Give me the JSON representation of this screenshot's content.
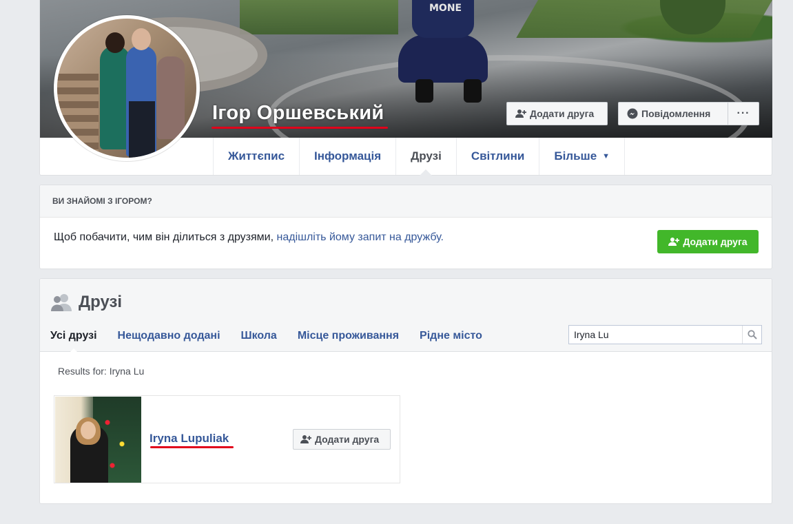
{
  "profile": {
    "name": "Ігор Оршевський",
    "cover_shirt_text": "MONE",
    "add_friend_label": "Додати друга",
    "message_label": "Повідомлення",
    "more_label": "···"
  },
  "nav": {
    "items": [
      {
        "label": "Життєпис"
      },
      {
        "label": "Інформація"
      },
      {
        "label": "Друзі"
      },
      {
        "label": "Світлини"
      },
      {
        "label": "Більше"
      }
    ],
    "active": "Друзі"
  },
  "know": {
    "header": "ВИ ЗНАЙОМІ З ІГОРОМ?",
    "text": "Щоб побачити, чим він ділиться з друзями, ",
    "link": "надішліть йому запит на дружбу.",
    "button": "Додати друга"
  },
  "friends": {
    "title": "Друзі",
    "tabs": [
      {
        "label": "Усі друзі"
      },
      {
        "label": "Нещодавно додані"
      },
      {
        "label": "Школа"
      },
      {
        "label": "Місце проживання"
      },
      {
        "label": "Рідне місто"
      }
    ],
    "active_tab": "Усі друзі",
    "search_value": "Iryna Lu",
    "results_for": "Results for: Iryna Lu",
    "results": [
      {
        "name": "Iryna Lupuliak",
        "button": "Додати друга"
      }
    ]
  },
  "colors": {
    "link": "#365899",
    "green": "#42b72a",
    "highlight": "#e1001a"
  }
}
